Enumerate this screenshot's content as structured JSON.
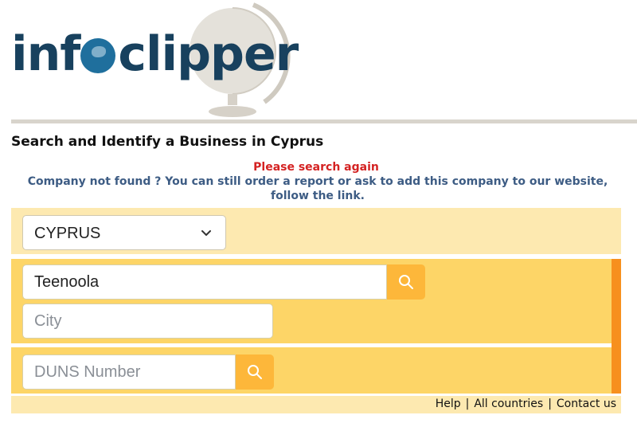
{
  "logo": {
    "part1": "inf",
    "part2": "clipper",
    "alt": "infoclipper"
  },
  "page_title": "Search and Identify a Business in Cyprus",
  "messages": {
    "error": "Please search again",
    "info": "Company not found ? You can still order a report or ask to add this company to our website, follow the link."
  },
  "country_select": {
    "value": "CYPRUS"
  },
  "company_search": {
    "value": "Teenoola",
    "placeholder": ""
  },
  "city": {
    "value": "",
    "placeholder": "City"
  },
  "duns": {
    "value": "",
    "placeholder": "DUNS Number"
  },
  "footer": {
    "help": "Help",
    "all_countries": "All countries",
    "contact": "Contact us",
    "separator": "|"
  },
  "colors": {
    "panel_light": "#fde9b0",
    "panel_dark": "#fdd567",
    "accent": "#f7901e",
    "button": "#fdb73a",
    "error": "#d42222",
    "info": "#3d5c84",
    "logo": "#18415e"
  },
  "icons": {
    "search": "search-icon",
    "chevron": "chevron-down-icon",
    "globe": "globe-icon"
  }
}
